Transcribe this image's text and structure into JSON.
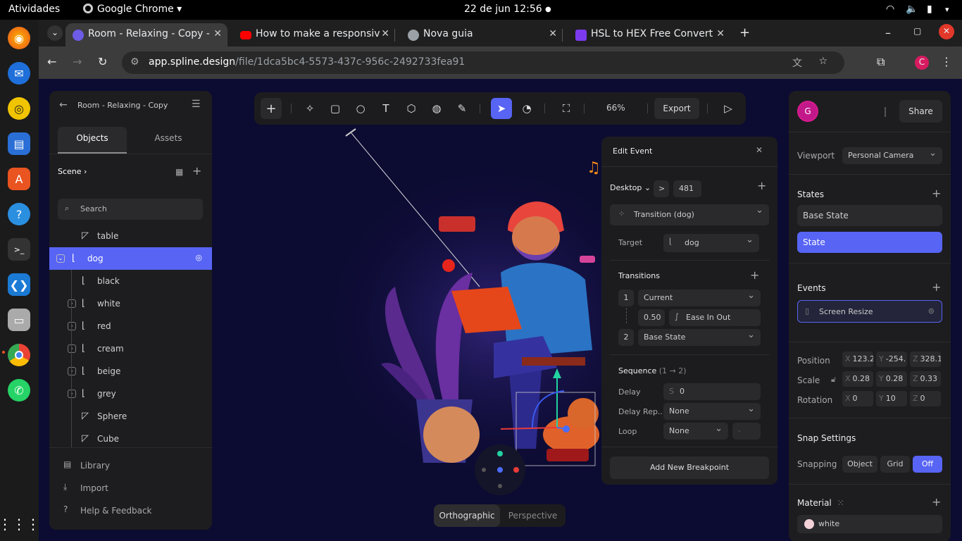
{
  "system": {
    "activities": "Atividades",
    "app_name": "Google Chrome",
    "datetime": "22 de jun  12:56"
  },
  "browser": {
    "tabs": [
      {
        "title": "Room - Relaxing - Copy -",
        "favicon_color": "#6c5ce7"
      },
      {
        "title": "How to make a responsiv",
        "favicon_color": "#ff0000"
      },
      {
        "title": "Nova guia",
        "favicon_color": "#9aa0a6"
      },
      {
        "title": "HSL to HEX Free Convert",
        "favicon_color": "#7c3aed"
      }
    ],
    "url_host": "app.spline.design",
    "url_path": "/file/1dca5bc4-5573-437c-956c-2492733fea91",
    "profile_initial": "C"
  },
  "left_panel": {
    "file_name": "Room - Relaxing - Copy",
    "tabs": [
      "Objects",
      "Assets"
    ],
    "scene_label": "Scene",
    "search_placeholder": "Search",
    "items": [
      {
        "label": "table",
        "kind": "shape"
      },
      {
        "label": "dog",
        "kind": "group",
        "selected": true
      },
      {
        "label": "black",
        "kind": "group"
      },
      {
        "label": "white",
        "kind": "group"
      },
      {
        "label": "red",
        "kind": "group"
      },
      {
        "label": "cream",
        "kind": "group"
      },
      {
        "label": "beige",
        "kind": "group"
      },
      {
        "label": "grey",
        "kind": "group"
      },
      {
        "label": "Sphere",
        "kind": "shape"
      },
      {
        "label": "Cube",
        "kind": "shape"
      }
    ],
    "footer": [
      "Library",
      "Import",
      "Help & Feedback"
    ]
  },
  "toolbar": {
    "zoom": "66%",
    "export_label": "Export"
  },
  "edit_event": {
    "title": "Edit Event",
    "breakpoint": "Desktop",
    "operator": ">",
    "breakpoint_value": "481",
    "action": "Transition (dog)",
    "target_label": "Target",
    "target_value": "dog",
    "transitions_label": "Transitions",
    "step1_num": "1",
    "step1_state": "Current",
    "duration": "0.50",
    "easing": "Ease In Out",
    "step2_num": "2",
    "step2_state": "Base State",
    "sequence_label": "Sequence",
    "sequence_range": "(1 → 2)",
    "delay_label": "Delay",
    "delay_prefix": "S",
    "delay_value": "0",
    "delay_rep_label": "Delay Rep...",
    "delay_rep_value": "None",
    "loop_label": "Loop",
    "loop_value": "None",
    "loop_count": "-",
    "add_breakpoint": "Add New Breakpoint"
  },
  "right_panel": {
    "avatar_initial": "G",
    "share_label": "Share",
    "viewport_label": "Viewport",
    "viewport_value": "Personal Camera",
    "states_label": "States",
    "base_state": "Base State",
    "state": "State",
    "events_label": "Events",
    "event_name": "Screen Resize",
    "position_label": "Position",
    "position": {
      "x": "123.2",
      "y": "-254.",
      "z": "328.1"
    },
    "scale_label": "Scale",
    "scale": {
      "x": "0.28",
      "y": "0.28",
      "z": "0.33"
    },
    "rotation_label": "Rotation",
    "rotation": {
      "x": "0",
      "y": "10",
      "z": "0"
    },
    "snap_label": "Snap Settings",
    "snapping_label": "Snapping",
    "snap_options": [
      "Object",
      "Grid",
      "Off"
    ],
    "material_label": "Material",
    "material_value": "white"
  },
  "view_modes": [
    "Orthographic",
    "Perspective"
  ],
  "colors": {
    "accent": "#5764f4",
    "panel": "#1d1d1f",
    "canvas": "#0c0b32"
  }
}
